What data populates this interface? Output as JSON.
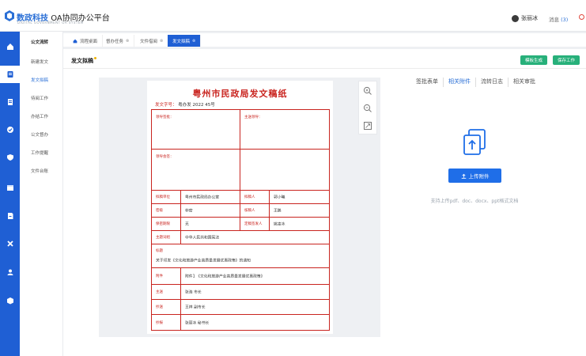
{
  "brand": {
    "name_main": "数政科技",
    "name_sub": "OA协同办公平台",
    "tagline": "DIGITAL GOVERNMENT OA SYSTEM"
  },
  "header": {
    "user_name": "张丽冰",
    "messages_label": "消息",
    "messages_count": "(3)"
  },
  "iconbar": {
    "items": [
      "home-icon",
      "document-icon",
      "file-icon",
      "check-icon",
      "shield-icon",
      "calendar-icon",
      "report-icon",
      "tool-icon",
      "user-icon",
      "box-icon"
    ]
  },
  "submenu": {
    "items": [
      "公文流转",
      "新建发文",
      "发文拟稿",
      "待阅工作",
      "办结工作",
      "公文督办",
      "工作提醒",
      "文件台账"
    ]
  },
  "tabs": [
    {
      "label": "流程桌面",
      "icon": "home"
    },
    {
      "label": "督办任务",
      "close": "⊗"
    },
    {
      "label": "文件借阅",
      "close": "⊗"
    },
    {
      "label": "发文拟稿",
      "close": "⊗"
    }
  ],
  "main": {
    "title": "发文拟稿",
    "btn_generate": "模板生成",
    "btn_save": "保存工作"
  },
  "document": {
    "title": "粤州市民政局发文稿纸",
    "no_label": "发文字号：",
    "no_value": "粤办发 2022 45号",
    "fields": {
      "leader_sign": "领导签批：",
      "review_sign": "主送领导：",
      "leader_opinion": "领导会签：",
      "draft_unit_label": "拟稿单位",
      "draft_unit_value": "粤州市民政局办公室",
      "drafter_label": "拟稿人",
      "drafter_value": "郭小曦",
      "secret_label": "密级",
      "secret_value": "非密",
      "reviewer_label": "核稿人",
      "reviewer_value": "王鹏",
      "period_label": "保密期限",
      "period_value": "无",
      "signer_label": "定稿签发人",
      "signer_value": "姚凌冰",
      "topic_label": "主题词组",
      "topic_value": "中华人民共和国宪法",
      "title_label": "标题",
      "title_value": "关于印发《文化和旅游产业高质量发展优惠政策》的通知",
      "attach_label": "附件",
      "attach_value": "附件1 《文化和旅游产业高质量发展优惠政策》",
      "main_to_label": "主送",
      "main_to_value": "张浩 市长",
      "copy_label": "抄送",
      "copy_value": "王祥 副市长",
      "cc_label": "抄报",
      "cc_value": "张丽冰 秘书长"
    }
  },
  "right": {
    "tabs": [
      "签批表单",
      "相关附件",
      "流转日志",
      "相关审批"
    ],
    "active_tab": "相关附件",
    "upload_label": "上传附件",
    "upload_hint": "支持上传pdf、doc、docx、ppt格式文档"
  }
}
